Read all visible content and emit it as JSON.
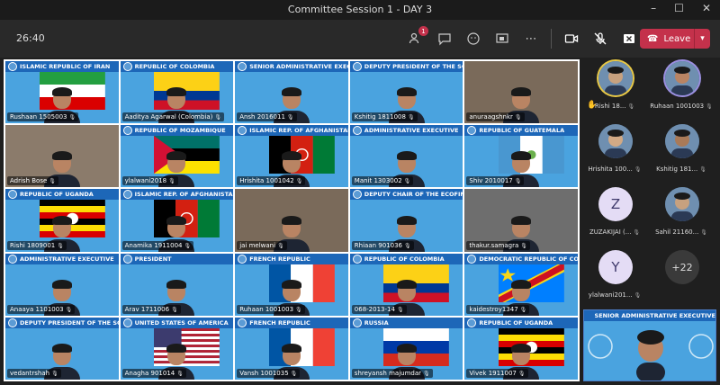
{
  "window": {
    "title": "Committee Session 1 - DAY 3"
  },
  "toolbar": {
    "timer": "26:40",
    "participants_badge": "1",
    "leave_label": "Leave"
  },
  "icons": [
    "people-icon",
    "chat-icon",
    "react-icon",
    "share-icon",
    "more-icon",
    "camera-icon",
    "mic-off-icon",
    "share-tray-icon"
  ],
  "colors": {
    "leave": "#c4314b",
    "banner": "#1d67b8",
    "tile_bg": "#4aa3df"
  },
  "tiles": [
    {
      "banner": "ISLAMIC REPUBLIC OF IRAN",
      "name": "Rushaan 1505003",
      "flag": "iran"
    },
    {
      "banner": "REPUBLIC OF COLOMBIA",
      "name": "Aaditya Agarwal (Colombia)",
      "flag": "colombia"
    },
    {
      "banner": "SENIOR ADMINISTRATIVE EXECUTIVE",
      "name": "Ansh 2016011",
      "flag": ""
    },
    {
      "banner": "DEPUTY PRESIDENT OF THE SC",
      "name": "Kshitig 1811008",
      "flag": ""
    },
    {
      "banner": "",
      "name": "anuraagshnkr",
      "flag": "room"
    },
    {
      "banner": "",
      "name": "Adrish Bose",
      "flag": "room"
    },
    {
      "banner": "REPUBLIC OF MOZAMBIQUE",
      "name": "ylalwani2018",
      "flag": "mozambique"
    },
    {
      "banner": "ISLAMIC REP. OF AFGHANISTAN",
      "name": "Hrishita 1001042",
      "flag": "afghanistan"
    },
    {
      "banner": "ADMINISTRATIVE EXECUTIVE",
      "name": "Manit 1303002",
      "flag": ""
    },
    {
      "banner": "REPUBLIC OF GUATEMALA",
      "name": "Shiv 2010017",
      "flag": "guatemala"
    },
    {
      "banner": "REPUBLIC OF UGANDA",
      "name": "Rishi 1809001",
      "flag": "uganda"
    },
    {
      "banner": "ISLAMIC REP. OF AFGHANISTAN",
      "name": "Anamika 1911004",
      "flag": "afghanistan"
    },
    {
      "banner": "",
      "name": "jai melwani",
      "flag": "room"
    },
    {
      "banner": "DEPUTY CHAIR OF THE ECOFIN",
      "name": "Rhiaan 901036",
      "flag": ""
    },
    {
      "banner": "",
      "name": "thakur.samagra",
      "flag": "room"
    },
    {
      "banner": "ADMINISTRATIVE EXECUTIVE",
      "name": "Anaaya 1101003",
      "flag": ""
    },
    {
      "banner": "PRESIDENT",
      "name": "Arav 1711006",
      "flag": ""
    },
    {
      "banner": "FRENCH REPUBLIC",
      "name": "Ruhaan 1001003",
      "flag": "france"
    },
    {
      "banner": "REPUBLIC OF COLOMBIA",
      "name": "068-2013-14",
      "flag": "colombia"
    },
    {
      "banner": "DEMOCRATIC REPUBLIC OF CONGO",
      "name": "kaidestroy1347",
      "flag": "drc"
    },
    {
      "banner": "DEPUTY PRESIDENT OF THE SC",
      "name": "vedantrshah",
      "flag": ""
    },
    {
      "banner": "UNITED STATES OF AMERICA",
      "name": "Anagha 901014",
      "flag": "usa"
    },
    {
      "banner": "FRENCH REPUBLIC",
      "name": "Vansh 1001035",
      "flag": "france"
    },
    {
      "banner": "RUSSIA",
      "name": "shreyansh majumdar",
      "flag": "russia"
    },
    {
      "banner": "REPUBLIC OF UGANDA",
      "name": "Vivek 1911007",
      "flag": "uganda"
    }
  ],
  "side_participants": [
    {
      "name": "Rishi 18...",
      "type": "photo",
      "ring": "y",
      "hand": "✋"
    },
    {
      "name": "Ruhaan 1001003",
      "type": "photo",
      "ring": "p",
      "hand": ""
    },
    {
      "name": "Hrishita 100...",
      "type": "photo",
      "ring": "",
      "hand": ""
    },
    {
      "name": "Kshitig 181...",
      "type": "photo",
      "ring": "",
      "hand": ""
    },
    {
      "name": "ZUZAKIJAI (...",
      "type": "letter",
      "letter": "Z",
      "ring": "",
      "hand": ""
    },
    {
      "name": "Sahil 21160...",
      "type": "photo",
      "ring": "",
      "hand": ""
    },
    {
      "name": "ylalwani201...",
      "type": "letter",
      "letter": "Y",
      "ring": "",
      "hand": ""
    },
    {
      "name": "",
      "type": "more",
      "letter": "+22",
      "ring": "",
      "hand": ""
    }
  ],
  "self_view": {
    "banner": "SENIOR ADMINISTRATIVE EXECUTIVE"
  }
}
